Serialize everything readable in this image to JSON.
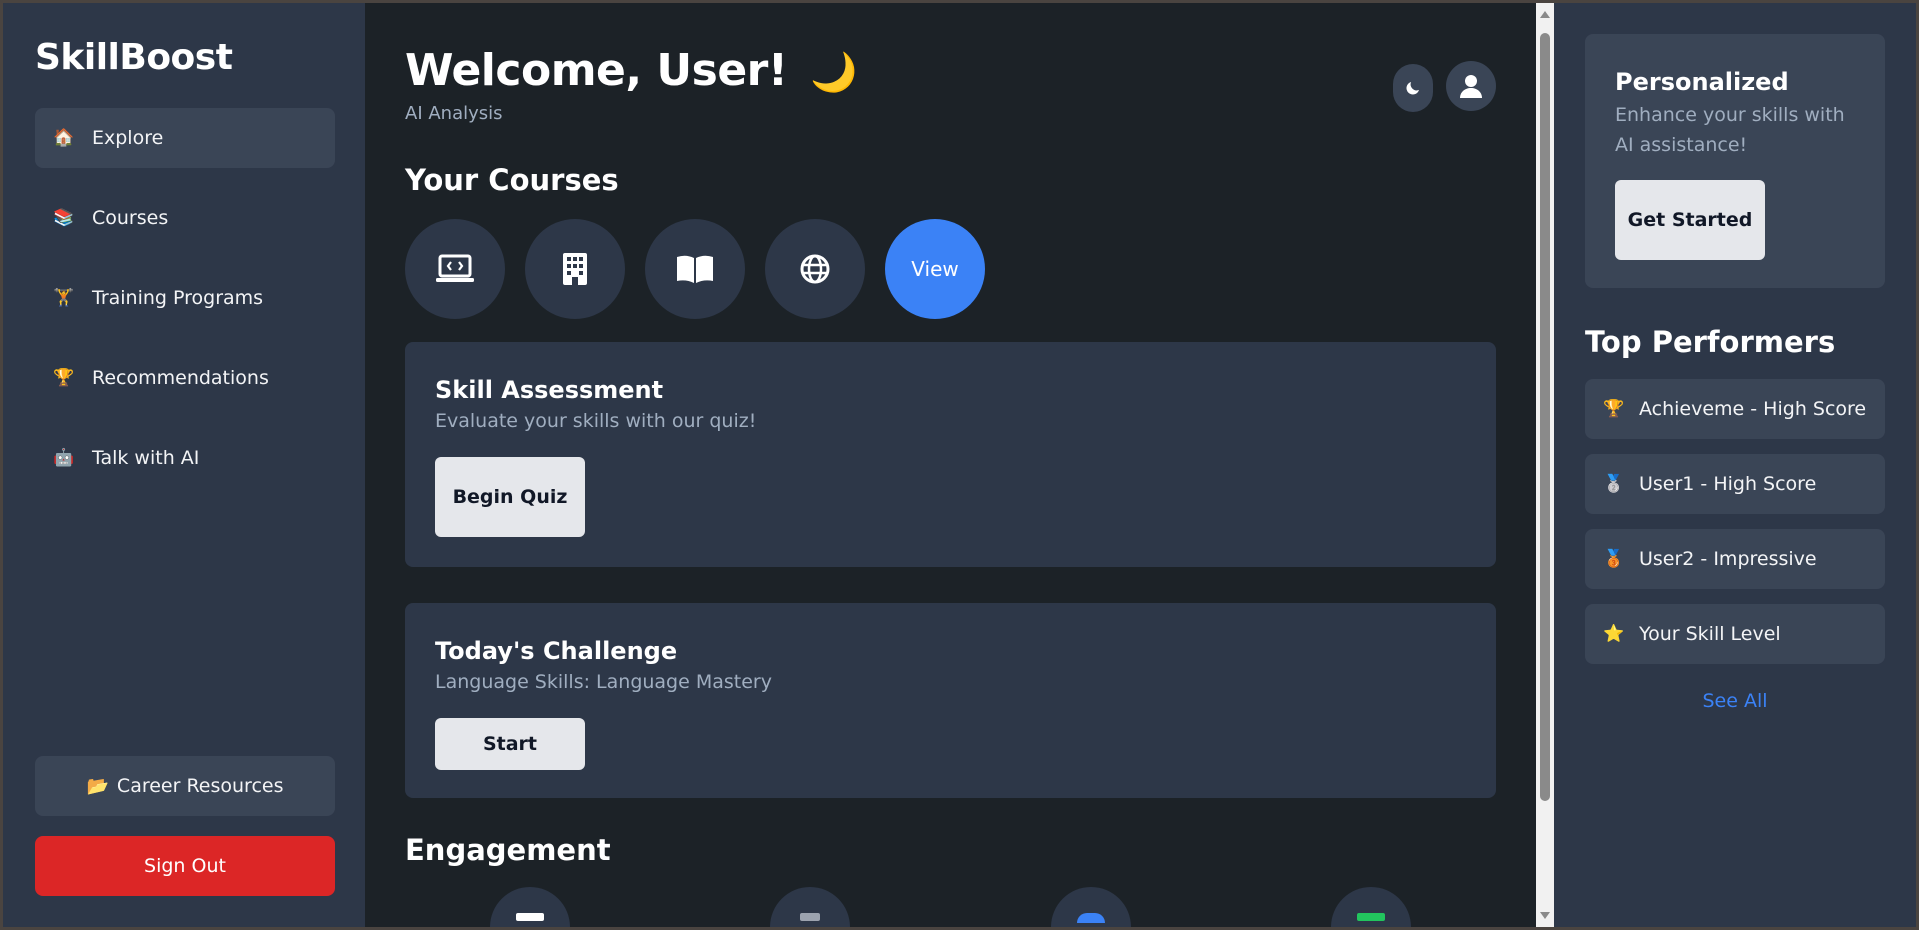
{
  "brand": "SkillBoost",
  "sidebar": {
    "items": [
      {
        "label": "Explore",
        "icon": "house-icon",
        "glyph": "🏠",
        "active": true
      },
      {
        "label": "Courses",
        "icon": "books-icon",
        "glyph": "📚"
      },
      {
        "label": "Training Programs",
        "icon": "training-icon",
        "glyph": "🏋"
      },
      {
        "label": "Recommendations",
        "icon": "trophy-icon",
        "glyph": "🏆"
      },
      {
        "label": "Talk with AI",
        "icon": "robot-icon",
        "glyph": "🤖"
      }
    ],
    "career_label": "Career Resources",
    "career_glyph": "📂",
    "signout_label": "Sign Out"
  },
  "header": {
    "welcome": "Welcome, User!",
    "welcome_glyph": "🌙",
    "subtitle": "AI Analysis"
  },
  "courses": {
    "title": "Your Courses",
    "icons": [
      "laptop-code-icon",
      "building-icon",
      "book-open-icon",
      "globe-icon"
    ],
    "view_label": "View"
  },
  "assessment": {
    "title": "Skill Assessment",
    "subtitle": "Evaluate your skills with our quiz!",
    "button": "Begin Quiz"
  },
  "challenge": {
    "title": "Today's Challenge",
    "subtitle": "Language Skills: Language Mastery",
    "button": "Start"
  },
  "engagement": {
    "title": "Engagement"
  },
  "promo": {
    "title": "Personalized",
    "subtitle": "Enhance your skills with AI assistance!",
    "button": "Get Started"
  },
  "top_performers": {
    "title": "Top Performers",
    "items": [
      {
        "label": "Achieveme - High Score",
        "icon": "trophy-icon",
        "glyph": "🏆"
      },
      {
        "label": "User1 - High Score",
        "icon": "silver-medal-icon",
        "glyph": "🥈"
      },
      {
        "label": "User2 - Impressive",
        "icon": "bronze-medal-icon",
        "glyph": "🥉"
      },
      {
        "label": "Your Skill Level",
        "icon": "star-icon",
        "glyph": "⭐"
      }
    ],
    "see_all": "See All"
  },
  "colors": {
    "accent": "#3b82f6",
    "danger": "#dc2626",
    "panel": "#2d3748",
    "background": "#1c2227"
  }
}
